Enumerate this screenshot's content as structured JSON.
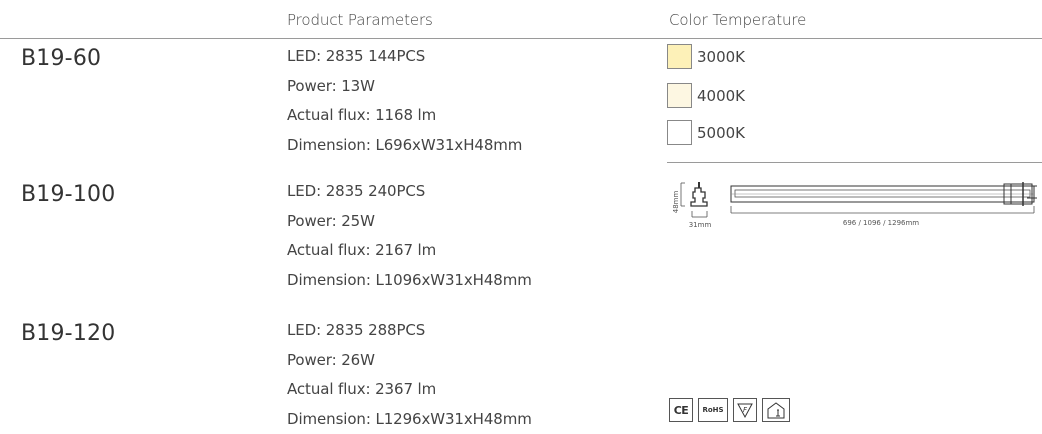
{
  "headers": {
    "params": "Product Parameters",
    "color_temp": "Color Temperature"
  },
  "products": [
    {
      "model": "B19-60",
      "led": "LED: 2835 144PCS",
      "power": "Power: 13W",
      "flux": "Actual flux: 1168 lm",
      "dimension": "Dimension: L696xW31xH48mm"
    },
    {
      "model": "B19-100",
      "led": "LED: 2835 240PCS",
      "power": "Power: 25W",
      "flux": "Actual flux: 2167 lm",
      "dimension": "Dimension: L1096xW31xH48mm"
    },
    {
      "model": "B19-120",
      "led": "LED: 2835 288PCS",
      "power": "Power: 26W",
      "flux": "Actual flux: 2367 lm",
      "dimension": "Dimension: L1296xW31xH48mm"
    }
  ],
  "color_temperatures": [
    {
      "label": "3000K",
      "color": "#fdf1b8"
    },
    {
      "label": "4000K",
      "color": "#fdf7e2"
    },
    {
      "label": "5000K",
      "color": "#ffffff"
    }
  ],
  "diagram": {
    "height_label": "48mm",
    "width_label": "31mm",
    "length_label": "696 / 1096 / 1296mm"
  },
  "certifications": {
    "ce": "CE",
    "rohs": "RoHS",
    "f": "F"
  }
}
